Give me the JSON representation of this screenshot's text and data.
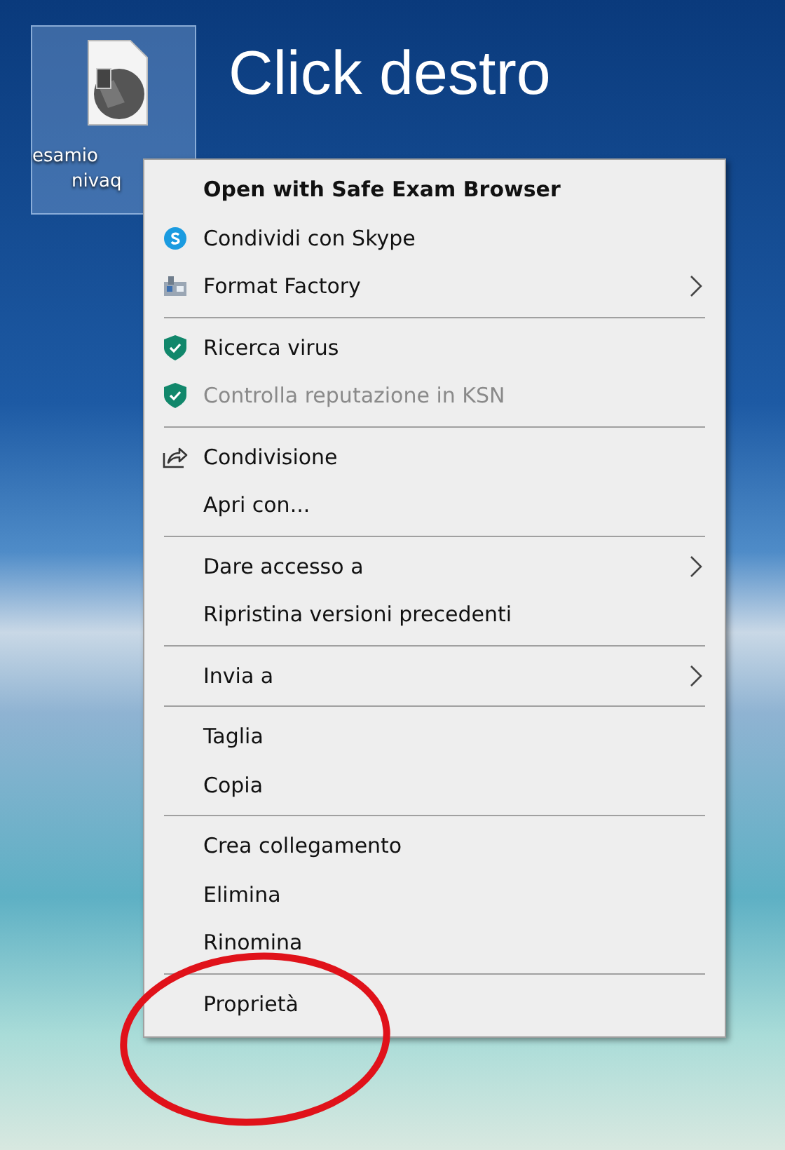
{
  "desktop_icon": {
    "label_lines": [
      "esamio",
      "nivaq"
    ],
    "selected": true
  },
  "heading": "Click destro",
  "context_menu": {
    "groups": [
      [
        {
          "label": "Open with Safe Exam Browser",
          "kind": "plain",
          "default": true,
          "disabled": false,
          "submenu": false
        },
        {
          "label": "Condividi con Skype",
          "kind": "skype",
          "default": false,
          "disabled": false,
          "submenu": false
        },
        {
          "label": "Format Factory",
          "kind": "factory",
          "default": false,
          "disabled": false,
          "submenu": true
        }
      ],
      [
        {
          "label": "Ricerca virus",
          "kind": "shield",
          "default": false,
          "disabled": false,
          "submenu": false
        },
        {
          "label": "Controlla reputazione in KSN",
          "kind": "shield",
          "default": false,
          "disabled": true,
          "submenu": false
        }
      ],
      [
        {
          "label": "Condivisione",
          "kind": "share",
          "default": false,
          "disabled": false,
          "submenu": false
        },
        {
          "label": "Apri con...",
          "kind": "plain",
          "default": false,
          "disabled": false,
          "submenu": false
        }
      ],
      [
        {
          "label": "Dare accesso a",
          "kind": "plain",
          "default": false,
          "disabled": false,
          "submenu": true
        },
        {
          "label": "Ripristina versioni precedenti",
          "kind": "plain",
          "default": false,
          "disabled": false,
          "submenu": false
        }
      ],
      [
        {
          "label": "Invia a",
          "kind": "plain",
          "default": false,
          "disabled": false,
          "submenu": true
        }
      ],
      [
        {
          "label": "Taglia",
          "kind": "plain",
          "default": false,
          "disabled": false,
          "submenu": false
        },
        {
          "label": "Copia",
          "kind": "plain",
          "default": false,
          "disabled": false,
          "submenu": false
        }
      ],
      [
        {
          "label": "Crea collegamento",
          "kind": "plain",
          "default": false,
          "disabled": false,
          "submenu": false
        },
        {
          "label": "Elimina",
          "kind": "plain",
          "default": false,
          "disabled": false,
          "submenu": false
        },
        {
          "label": "Rinomina",
          "kind": "plain",
          "default": false,
          "disabled": false,
          "submenu": false
        }
      ],
      [
        {
          "label": "Proprietà",
          "kind": "plain",
          "default": false,
          "disabled": false,
          "submenu": false
        }
      ]
    ]
  },
  "annotation": {
    "kind": "ellipse"
  }
}
